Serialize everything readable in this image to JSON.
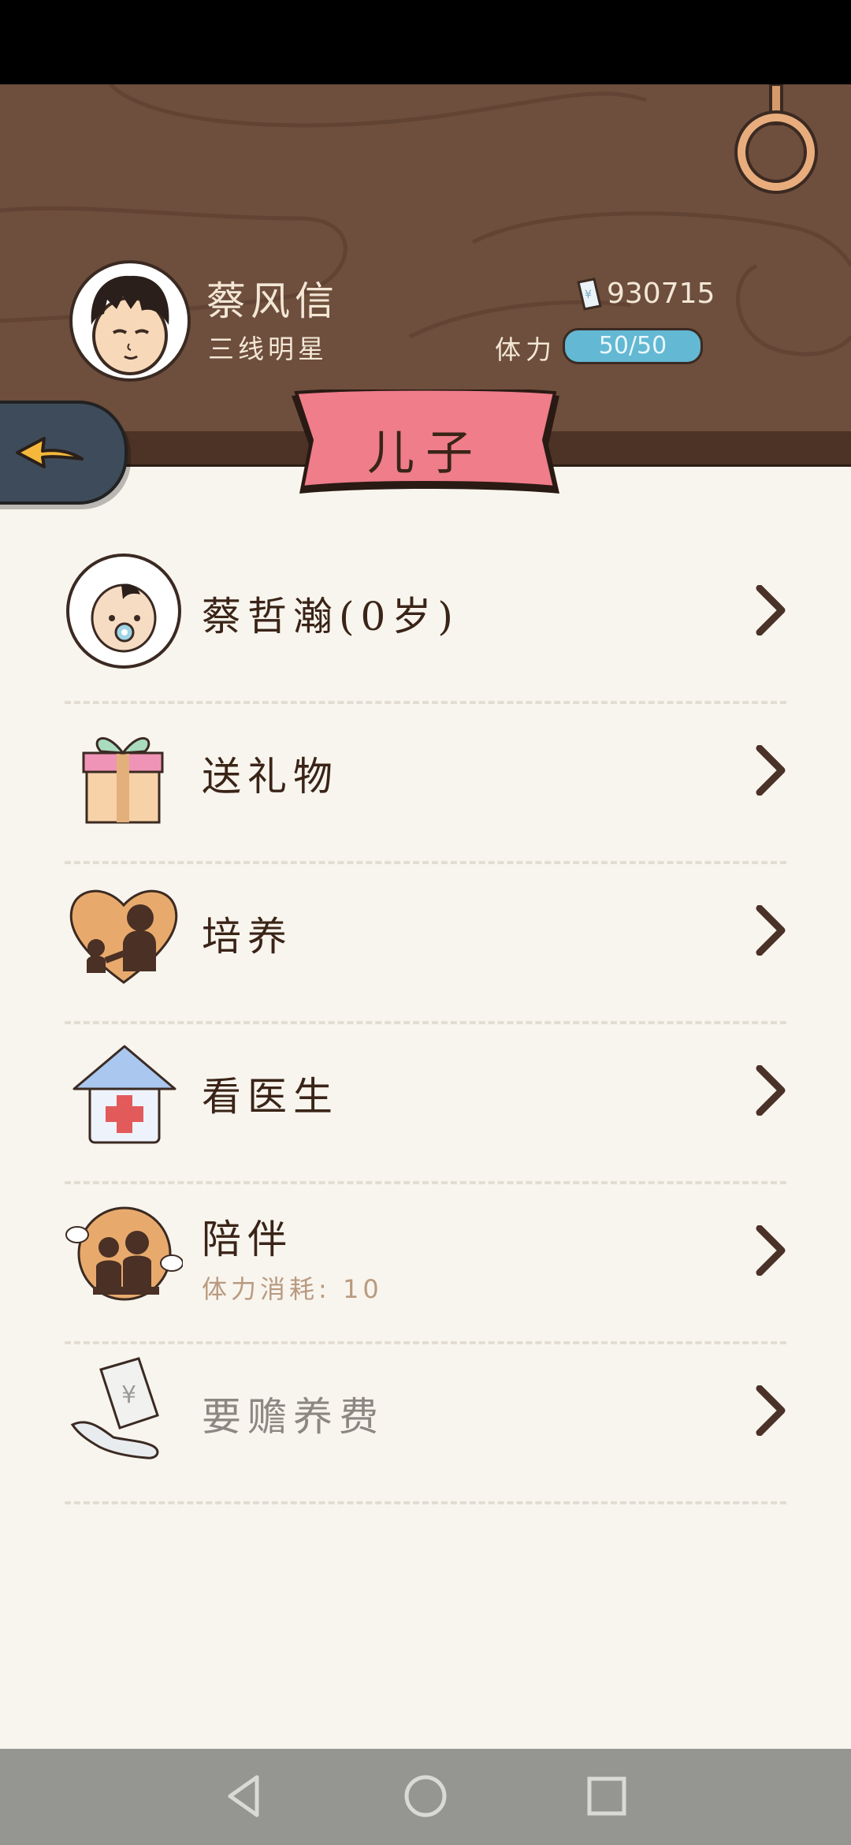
{
  "player": {
    "name": "蔡风信",
    "rank": "三线明星",
    "money": "930715",
    "stamina_label": "体力",
    "stamina_value": "50/50"
  },
  "page": {
    "title": "儿子"
  },
  "menu": {
    "items": [
      {
        "label": "蔡哲瀚(0岁)",
        "icon": "baby-avatar-icon"
      },
      {
        "label": "送礼物",
        "icon": "gift-icon"
      },
      {
        "label": "培养",
        "icon": "nurture-heart-icon"
      },
      {
        "label": "看医生",
        "icon": "hospital-icon"
      },
      {
        "label": "陪伴",
        "sub": "体力消耗: 10",
        "icon": "companion-icon"
      },
      {
        "label": "要赡养费",
        "icon": "money-hand-icon",
        "disabled": true
      }
    ]
  },
  "colors": {
    "header_wood": "#6e4e3c",
    "banner_pink": "#ef7d8a",
    "stamina_blue": "#63b8d3",
    "background": "#f8f5ee"
  }
}
